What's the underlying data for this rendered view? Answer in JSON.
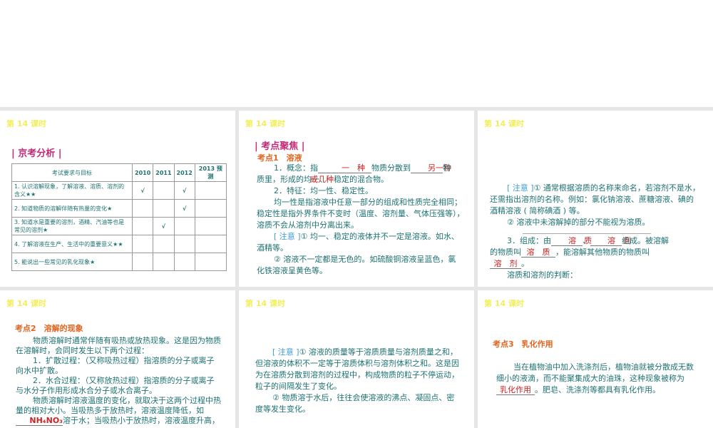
{
  "lesson_label": "第 14 课时",
  "slide1": {
    "heading": "| 京考分析 |",
    "table": {
      "headers": [
        "考试要求与目标",
        "2010",
        "2011",
        "2012",
        "2013 预测"
      ],
      "rows": [
        [
          "1. 认识溶解现象，了解溶液、溶质、溶剂的含义★★",
          "√",
          "",
          "√",
          ""
        ],
        [
          "2. 知道物质的溶解伴随有热量的变化★",
          "",
          "",
          "√",
          ""
        ],
        [
          "3. 知道水是重要的溶剂，酒精、汽油等也是常见的溶剂★",
          "",
          "√",
          "",
          ""
        ],
        [
          "4. 了解溶液在生产、生活中的重要意义★★",
          "",
          "",
          "",
          ""
        ],
        [
          "5. 能说出一些常见的乳化现象★",
          "",
          "",
          "",
          ""
        ]
      ]
    }
  },
  "slide2": {
    "heading": "| 考点聚焦 |",
    "topic": "考点1　溶液",
    "l1a": "1．概念：指",
    "ans1": "一　种",
    "l1b": "物质分散到",
    "ans2": "另一种",
    "l1c": "物",
    "l2a": "质里，形成的均一、",
    "ans3": "或几种",
    "l2b": "稳定的混合物。",
    "l3": "2．特征：均一性、稳定性。",
    "l4": "均一性是指溶液中任意一部分的组成和性质完全相同；",
    "l5": "稳定性是指外界条件不变时（温度、溶剂量、气体压强等），",
    "l6": "溶质不会从溶剂中分离出来。",
    "note": "[ 注意 ]",
    "l7": "① 均一、稳定的液体并不一定是溶液。如水、",
    "l8": "酒精等。",
    "l9": "② 溶液不一定都是无色的。如硫酸铜溶液呈蓝色，氯",
    "l10": "化铁溶液呈黄色等。"
  },
  "slide3": {
    "note": "[ 注意 ]",
    "l1": "① 通常根据溶质的名称来命名，若溶剂不是水，",
    "l2": "还需指出溶剂的名称。例如：氯化钠溶液、蔗糖溶液、碘的",
    "l3": "酒精溶液 ( 简称碘酒 ) 等。",
    "l4": "② 溶液中未溶解掉的部分不能视为溶质。",
    "l5a": "3．组成：由",
    "ans1": "溶　质",
    "l5b": "、",
    "ans2": "溶　剂",
    "l5c": "组成。被溶解",
    "l6a": "的物质叫",
    "ans3": "溶　质",
    "l6b": "，能溶解其他物质的物质叫",
    "ans4": "溶　剂",
    "l7b": "。",
    "l8": "溶质和溶剂的判断："
  },
  "slide4": {
    "topic": "考点2　溶解的现象",
    "lines": [
      "物质溶解时通常伴随有吸热或放热现象。这是因为物质",
      "在溶解时，会同时发生以下两个过程：",
      "1．扩散过程：（又称吸热过程）指溶质的分子或离子",
      "向水中扩散。",
      "2．水合过程：（又称放热过程）指溶质的分子或离子",
      "与水分子作用形成水合分子或水合离子。",
      "物质溶解时溶液温度的变化，就取决于这两个过程中热",
      "量的相对大小。当吸热多于放热时，溶液温度降低，如"
    ],
    "ans1": "NH₄NO₃",
    "l9b": "溶于水；当吸热小于放热时，溶液温度升高，"
  },
  "slide5": {
    "note": "[ 注意 ]",
    "lines": [
      "① 溶液的质量等于溶质质量与溶剂质量之和，",
      "但溶液的体积不一定等于溶质体积与溶剂体积之和。这是因",
      "为在溶质分散到溶剂的过程中，构成物质的粒子不停运动，",
      "粒子的间隔发生了变化。",
      "② 物质溶于水后，往往会使溶液的沸点、凝固点、密",
      "度等发生变化。"
    ]
  },
  "slide6": {
    "topic": "考点3　乳化作用",
    "l1": "当在植物油中加入洗涤剂后，植物油就被分散成无数",
    "l2": "细小的液滴，而不能聚集成大的油珠，这种现象被称为",
    "ans1": "乳化作用",
    "l3b": "。肥皂、洗涤剂等都具有乳化作用。"
  }
}
